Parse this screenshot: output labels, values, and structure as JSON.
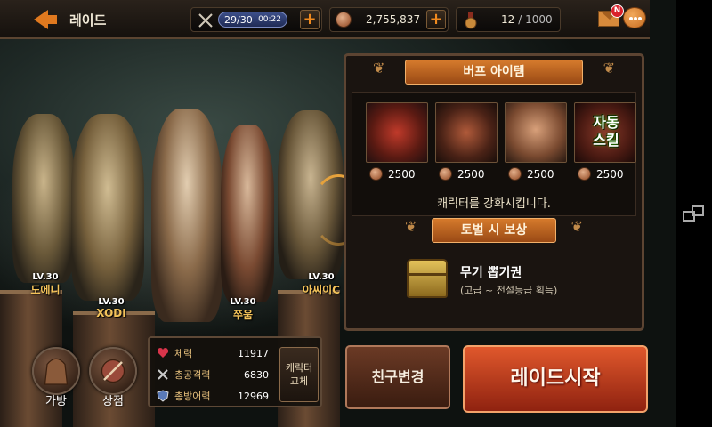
{
  "topbar": {
    "back_label": "레이드",
    "stamina": {
      "value": "29/30",
      "timer": "00:22"
    },
    "gold": "2,755,837",
    "medal": "12",
    "medal_max": "/ 1000",
    "mail_badge": "N"
  },
  "characters": [
    {
      "level": "LV.30",
      "name": "도에니"
    },
    {
      "level": "LV.30",
      "name": "XODI"
    },
    {
      "level": "LV.30",
      "name": "쭈움"
    },
    {
      "level": "LV.30",
      "name": "아씨이C"
    }
  ],
  "menu": {
    "bag": "가방",
    "shop": "상점"
  },
  "stats": {
    "hp_label": "체력",
    "hp": "11917",
    "atk_label": "총공격력",
    "atk": "6830",
    "def_label": "총방어력",
    "def": "12969",
    "swap_label_1": "캐릭터",
    "swap_label_2": "교체"
  },
  "buff": {
    "title": "버프 아이템",
    "items": [
      {
        "price": "2500",
        "icon": "weapon-icon"
      },
      {
        "price": "2500",
        "icon": "shield-icon"
      },
      {
        "price": "2500",
        "icon": "body-armor-icon"
      },
      {
        "price": "2500",
        "icon": "auto-skill-icon",
        "label_1": "자동",
        "label_2": "스킬"
      }
    ],
    "description": "캐릭터를 강화시킵니다."
  },
  "reward": {
    "title": "토벌 시 보상",
    "item_name": "무기 뽑기권",
    "item_desc": "(고급 ~ 전설등급 획득)"
  },
  "buttons": {
    "friend": "친구변경",
    "start": "레이드시작"
  },
  "colors": {
    "accent_orange": "#e0791f",
    "start_button": "#c8401c",
    "panel_border": "#5c4432"
  }
}
